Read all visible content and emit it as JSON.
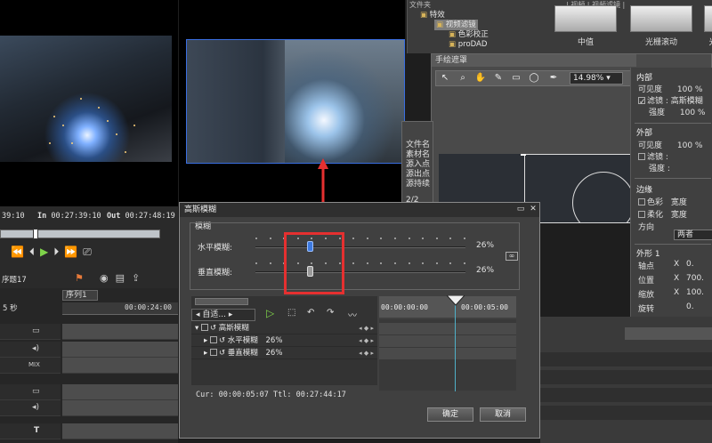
{
  "left_preview": {
    "timecode_a": "39:10",
    "in_label": "In",
    "in_time": "00:27:39:10",
    "out_label": "Out",
    "out_time": "00:27:48:19"
  },
  "left_timeline": {
    "sequence_tab": "序列1",
    "name": "序题17",
    "unit": "5 秒",
    "ruler_time": "00:00:24:00",
    "track_mix": "MIX",
    "track_t": "T"
  },
  "effects_tree": {
    "root": "特效",
    "filters": "视频滤镜",
    "color_correct": "色彩校正",
    "prodad": "proDAD",
    "tab_file": "文件夹",
    "tab_path": "| 视频 | 视频滤镜 |"
  },
  "effects_thumbs": [
    "中值",
    "光栅滚动",
    "光"
  ],
  "mask_window": {
    "title": "手绘遮罩",
    "zoom": "14.98%"
  },
  "info_panel": [
    "文件名",
    "素材名",
    "源入点",
    "源出点",
    "源持续",
    "2/2"
  ],
  "properties": {
    "inner_header": "内部",
    "visibility_label": "可见度",
    "visibility_value": "100 %",
    "filter_label": "滤镜",
    "filter_value": "高斯模糊",
    "strength_label": "强度",
    "strength_value": "100 %",
    "outer_header": "外部",
    "outer_visibility_label": "可见度",
    "outer_visibility_value": "100 %",
    "outer_filter_label": "滤镜",
    "outer_strength_label": "强度",
    "edge_header": "边缘",
    "color_label": "色彩",
    "width_label": "宽度",
    "soft_label": "柔化",
    "soft_width_label": "宽度",
    "direction_label": "方向",
    "direction_value": "两者",
    "shape_header": "外形 1",
    "axis_label": "轴点",
    "axis_x": "X",
    "axis_x_value": "0.",
    "position_label": "位置",
    "position_x": "X",
    "position_x_value": "700.",
    "scale_label": "缩放",
    "scale_x": "X",
    "scale_x_value": "100.",
    "rotate_label": "旋转",
    "rotate_value": "0."
  },
  "dialog": {
    "title": "高斯模糊",
    "group_label": "模糊",
    "horizontal_label": "水平模糊:",
    "horizontal_value": "26%",
    "horizontal_level": 0.26,
    "vertical_label": "垂直模糊:",
    "vertical_value": "26%",
    "vertical_level": 0.26,
    "mode_label": "自适...",
    "kf_rows": [
      {
        "label": "高斯模糊",
        "value": ""
      },
      {
        "label": "水平模糊",
        "value": "26%"
      },
      {
        "label": "垂直模糊",
        "value": "26%"
      }
    ],
    "ruler_start": "00:00:00:00",
    "ruler_mark": "00:00:05:00",
    "status": "Cur: 00:00:05:07  Ttl: 00:27:44:17",
    "ok_label": "确定",
    "cancel_label": "取消"
  }
}
